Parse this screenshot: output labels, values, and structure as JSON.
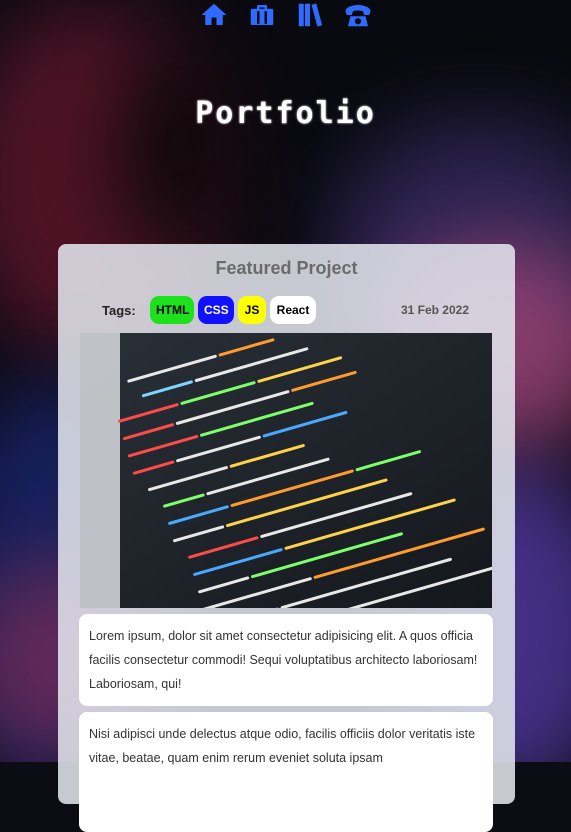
{
  "nav": {
    "items": [
      {
        "icon": "home-icon"
      },
      {
        "icon": "briefcase-icon"
      },
      {
        "icon": "books-icon"
      },
      {
        "icon": "phone-icon"
      }
    ],
    "icon_color": "#2f6bff"
  },
  "page": {
    "title": "Portfolio"
  },
  "project": {
    "heading": "Featured Project",
    "tags_label": "Tags:",
    "tags": [
      "HTML",
      "CSS",
      "JS",
      "React"
    ],
    "date": "31 Feb 2022",
    "image_icon": "code-screenshot-image",
    "paragraphs": [
      "Lorem ipsum, dolor sit amet consectetur adipisicing elit. A quos officia facilis consectetur commodi! Sequi voluptatibus architecto laboriosam! Laboriosam, qui!",
      "Nisi adipisci unde delectus atque odio, facilis officiis dolor veritatis iste vitae, beatae, quam enim rerum eveniet soluta ipsam"
    ]
  },
  "colors": {
    "tag_html": "#1ce11c",
    "tag_css": "#1111ff",
    "tag_js": "#ffff00",
    "tag_react": "#ffffff"
  }
}
